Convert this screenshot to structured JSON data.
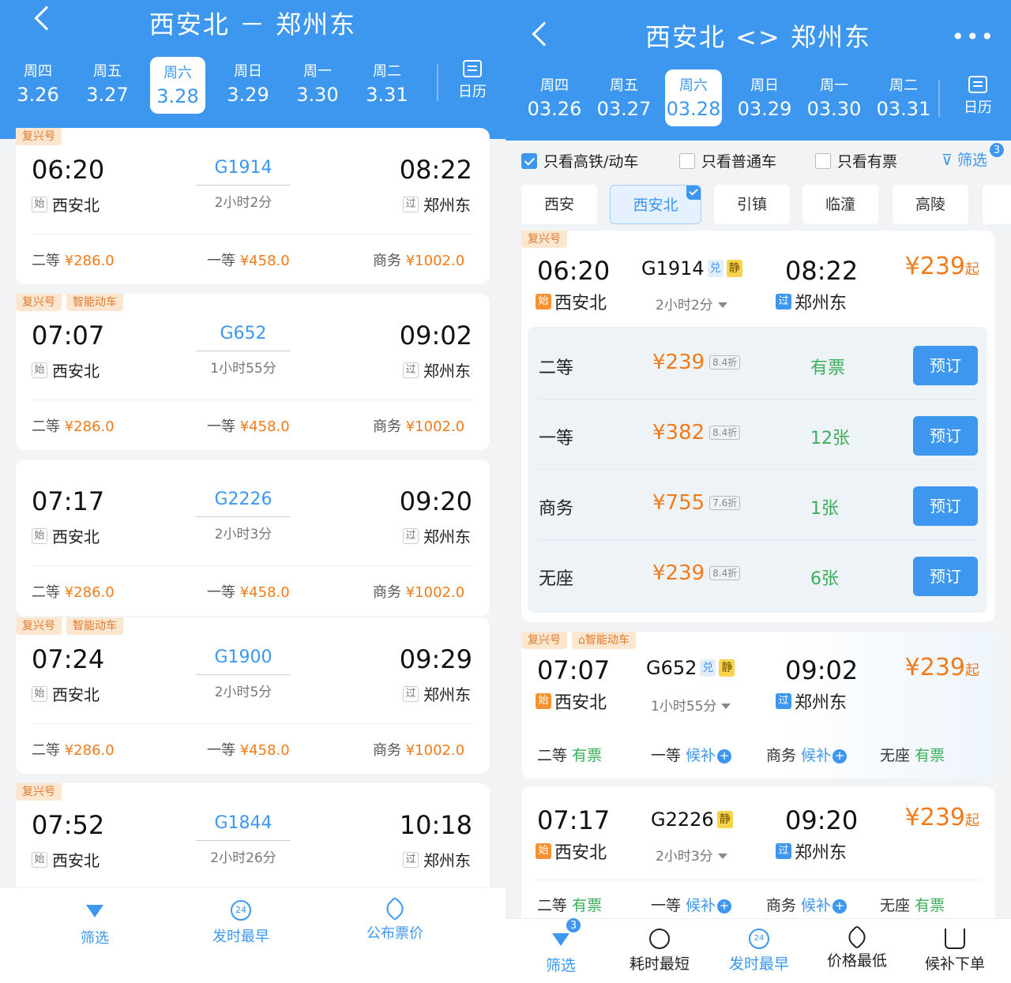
{
  "left": {
    "title": "西安北 － 郑州东",
    "dates": [
      {
        "week": "周四",
        "day": "3.26"
      },
      {
        "week": "周五",
        "day": "3.27"
      },
      {
        "week": "周六",
        "day": "3.28"
      },
      {
        "week": "周日",
        "day": "3.29"
      },
      {
        "week": "周一",
        "day": "3.30"
      },
      {
        "week": "周二",
        "day": "3.31"
      }
    ],
    "active_date_index": 2,
    "calendar_label": "日历",
    "trains": [
      {
        "tags": [
          "复兴号"
        ],
        "dep": "06:20",
        "no": "G1914",
        "dur": "2小时2分",
        "arr": "08:22",
        "from_mark": "始",
        "from": "西安北",
        "to_mark": "过",
        "to": "郑州东",
        "p1_label": "二等",
        "p1": "¥286.0",
        "p2_label": "一等",
        "p2": "¥458.0",
        "p3_label": "商务",
        "p3": "¥1002.0"
      },
      {
        "tags": [
          "复兴号",
          "智能动车"
        ],
        "dep": "07:07",
        "no": "G652",
        "dur": "1小时55分",
        "arr": "09:02",
        "from_mark": "始",
        "from": "西安北",
        "to_mark": "过",
        "to": "郑州东",
        "p1_label": "二等",
        "p1": "¥286.0",
        "p2_label": "一等",
        "p2": "¥458.0",
        "p3_label": "商务",
        "p3": "¥1002.0"
      },
      {
        "tags": [],
        "dep": "07:17",
        "no": "G2226",
        "dur": "2小时3分",
        "arr": "09:20",
        "from_mark": "始",
        "from": "西安北",
        "to_mark": "过",
        "to": "郑州东",
        "p1_label": "二等",
        "p1": "¥286.0",
        "p2_label": "一等",
        "p2": "¥458.0",
        "p3_label": "商务",
        "p3": "¥1002.0"
      },
      {
        "tags": [
          "复兴号",
          "智能动车"
        ],
        "dep": "07:24",
        "no": "G1900",
        "dur": "2小时5分",
        "arr": "09:29",
        "from_mark": "始",
        "from": "西安北",
        "to_mark": "过",
        "to": "郑州东",
        "p1_label": "二等",
        "p1": "¥286.0",
        "p2_label": "一等",
        "p2": "¥458.0",
        "p3_label": "商务",
        "p3": "¥1002.0"
      },
      {
        "tags": [
          "复兴号"
        ],
        "dep": "07:52",
        "no": "G1844",
        "dur": "2小时26分",
        "arr": "10:18",
        "from_mark": "始",
        "from": "西安北",
        "to_mark": "过",
        "to": "郑州东"
      }
    ],
    "bottom": [
      {
        "label": "筛选",
        "icon": "filter-icon"
      },
      {
        "label": "发时最早",
        "icon": "24-clock-icon",
        "glyph": "24"
      },
      {
        "label": "公布票价",
        "icon": "price-tag-icon"
      }
    ]
  },
  "right": {
    "title": "西安北 <> 郑州东",
    "more": "•••",
    "dates": [
      {
        "week": "周四",
        "day": "03.26"
      },
      {
        "week": "周五",
        "day": "03.27"
      },
      {
        "week": "周六",
        "day": "03.28"
      },
      {
        "week": "周日",
        "day": "03.29"
      },
      {
        "week": "周一",
        "day": "03.30"
      },
      {
        "week": "周二",
        "day": "03.31"
      }
    ],
    "active_date_index": 2,
    "calendar_label": "日历",
    "filters": [
      {
        "label": "只看高铁/动车",
        "checked": true
      },
      {
        "label": "只看普通车",
        "checked": false
      },
      {
        "label": "只看有票",
        "checked": false
      }
    ],
    "screen_label": "筛选",
    "screen_count": "3",
    "stations": [
      "西安",
      "西安北",
      "引镇",
      "临潼",
      "高陵"
    ],
    "active_station_index": 1,
    "train1": {
      "tag": "复兴号",
      "dep": "06:20",
      "no": "G1914",
      "b1": "兑",
      "b2": "静",
      "dur": "2小时2分",
      "arr": "08:22",
      "from_mark": "始",
      "from": "西安北",
      "to_mark": "过",
      "to": "郑州东",
      "price": "¥239",
      "price_suffix": "起",
      "seats": [
        {
          "name": "二等",
          "price": "¥239",
          "disc": "8.4折",
          "avail": "有票",
          "btn": "预订"
        },
        {
          "name": "一等",
          "price": "¥382",
          "disc": "8.4折",
          "avail": "12张",
          "btn": "预订"
        },
        {
          "name": "商务",
          "price": "¥755",
          "disc": "7.6折",
          "avail": "1张",
          "btn": "预订"
        },
        {
          "name": "无座",
          "price": "¥239",
          "disc": "8.4折",
          "avail": "6张",
          "btn": "预订"
        }
      ]
    },
    "train2": {
      "tag1": "复兴号",
      "tag2": "智能动车",
      "dep": "07:07",
      "no": "G652",
      "b1": "兑",
      "b2": "静",
      "dur": "1小时55分",
      "arr": "09:02",
      "from_mark": "始",
      "from": "西安北",
      "to_mark": "过",
      "to": "郑州东",
      "price": "¥239",
      "price_suffix": "起",
      "s1": "二等",
      "s1v": "有票",
      "s2": "一等",
      "s2v": "候补",
      "s3": "商务",
      "s3v": "候补",
      "s4": "无座",
      "s4v": "有票"
    },
    "train3": {
      "dep": "07:17",
      "no": "G2226",
      "b2": "静",
      "dur": "2小时3分",
      "arr": "09:20",
      "from_mark": "始",
      "from": "西安北",
      "to_mark": "过",
      "to": "郑州东",
      "price": "¥239",
      "price_suffix": "起",
      "s1": "二等",
      "s1v": "有票",
      "s2": "一等",
      "s2v": "候补",
      "s3": "商务",
      "s3v": "候补",
      "s4": "无座",
      "s4v": "有票"
    },
    "bottom": [
      {
        "label": "筛选",
        "icon": "filter-icon",
        "badge": "3"
      },
      {
        "label": "耗时最短",
        "icon": "stopwatch-icon"
      },
      {
        "label": "发时最早",
        "icon": "24-clock-icon",
        "glyph": "24"
      },
      {
        "label": "价格最低",
        "icon": "price-tag-icon"
      },
      {
        "label": "候补下单",
        "icon": "cart-icon"
      }
    ]
  },
  "colors": {
    "primary": "#3d97ee",
    "price": "#f07b1a",
    "available": "#3cae5a"
  }
}
